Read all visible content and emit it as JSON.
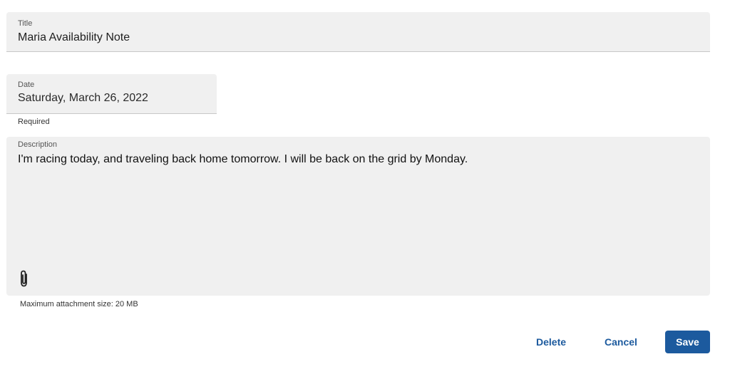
{
  "form": {
    "title": {
      "label": "Title",
      "value": "Maria Availability Note"
    },
    "date": {
      "label": "Date",
      "value": "Saturday, March 26, 2022",
      "helper": "Required"
    },
    "description": {
      "label": "Description",
      "value": "I'm racing today, and traveling back home tomorrow. I will be back on the grid by Monday.",
      "attach_icon": "paperclip-icon",
      "attachment_helper": "Maximum attachment size: 20 MB"
    }
  },
  "actions": {
    "delete_label": "Delete",
    "cancel_label": "Cancel",
    "save_label": "Save"
  },
  "colors": {
    "accent": "#1c5a9e",
    "field_background": "#f0f0f0"
  }
}
